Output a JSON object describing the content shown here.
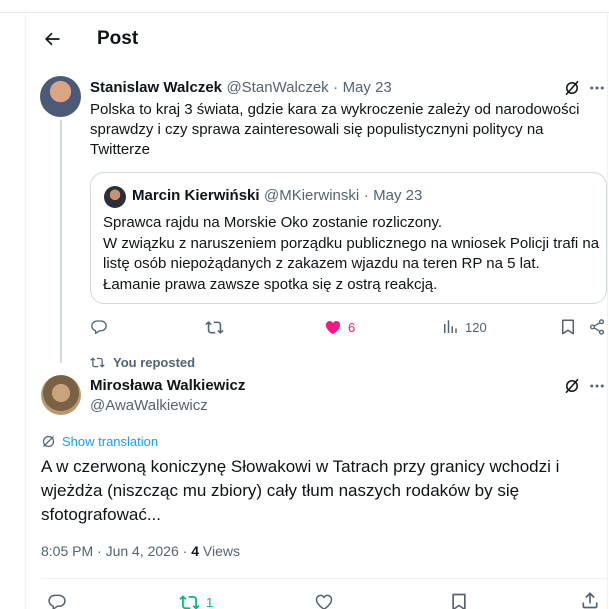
{
  "header": {
    "title": "Post"
  },
  "quoted_tweet": {
    "author_name": "Stanislaw Walczek",
    "author_handle": "@StanWalczek",
    "date": "May 23",
    "text": "Polska to kraj 3 świata, gdzie kara za wykroczenie zależy od narodowości sprawdzy i czy sprawa zainteresowali się populistycznyni politycy na Twitterze",
    "inner_quote": {
      "author_name": "Marcin Kierwiński",
      "author_handle": "@MKierwinski",
      "date": "May 23",
      "lines": [
        "Sprawca rajdu na Morskie Oko zostanie rozliczony.",
        "W związku z naruszeniem porządku publicznego na wniosek Policji trafi na listę osób niepożądanych z zakazem wjazdu na teren RP na 5 lat.",
        "Łamanie prawa zawsze spotka się z ostrą reakcją."
      ]
    },
    "actions": {
      "replies": "",
      "reposts": "",
      "likes": "6",
      "views": "120"
    }
  },
  "repost_banner": "You reposted",
  "main_tweet": {
    "author_name": "Mirosława Walkiewicz",
    "author_handle": "@AwaWalkiewicz",
    "show_translation": "Show translation",
    "text": "A w czerwoną koniczynę Słowakowi w Tatrach przy granicy wchodzi i wjeżdża (niszcząc mu zbiory) cały tłum naszych rodaków by się sfotografować...",
    "timestamp": "8:05 PM · Jun 4, 2026 · ",
    "views_count": "4",
    "views_label": " Views",
    "actions": {
      "reposts": "1"
    }
  },
  "colors": {
    "like": "#f91880",
    "repost": "#00ba7c",
    "link": "#1d9bf0",
    "muted": "#536471"
  },
  "icons": [
    "back-arrow-icon",
    "grok-icon",
    "more-icon",
    "reply-icon",
    "repost-icon",
    "like-icon",
    "views-icon",
    "bookmark-icon",
    "share-icon",
    "translate-icon"
  ]
}
